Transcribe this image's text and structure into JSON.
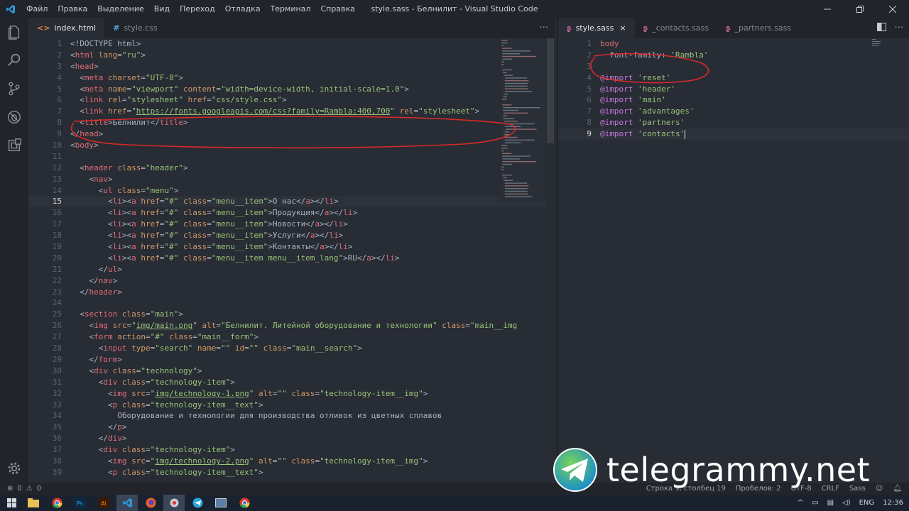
{
  "window": {
    "title": "style.sass - Белнилит - Visual Studio Code",
    "menu": [
      "Файл",
      "Правка",
      "Выделение",
      "Вид",
      "Переход",
      "Отладка",
      "Терминал",
      "Справка"
    ]
  },
  "left_editor": {
    "tabs": [
      {
        "label": "index.html",
        "icon": "html-file-icon",
        "active": true
      },
      {
        "label": "style.css",
        "icon": "css-file-icon",
        "active": false
      }
    ],
    "more_label": "···",
    "current_line": 15,
    "lines": [
      {
        "n": "1",
        "indent": "",
        "html": "<span class='p'>&lt;!DOCTYPE html&gt;</span>"
      },
      {
        "n": "2",
        "indent": "",
        "html": "<span class='p'>&lt;</span><span class='t'>html</span> <span class='a'>lang</span><span class='p'>=</span><span class='s'>\"ru\"</span><span class='p'>&gt;</span>"
      },
      {
        "n": "3",
        "indent": "",
        "html": "<span class='p'>&lt;</span><span class='t'>head</span><span class='p'>&gt;</span>"
      },
      {
        "n": "4",
        "indent": "  ",
        "html": "<span class='p'>&lt;</span><span class='t'>meta</span> <span class='a'>charset</span><span class='p'>=</span><span class='s'>\"UTF-8\"</span><span class='p'>&gt;</span>"
      },
      {
        "n": "5",
        "indent": "  ",
        "html": "<span class='p'>&lt;</span><span class='t'>meta</span> <span class='a'>name</span><span class='p'>=</span><span class='s'>\"viewport\"</span> <span class='a'>content</span><span class='p'>=</span><span class='s'>\"width=device-width, initial-scale=1.0\"</span><span class='p'>&gt;</span>"
      },
      {
        "n": "6",
        "indent": "  ",
        "html": "<span class='p'>&lt;</span><span class='t'>link</span> <span class='a'>rel</span><span class='p'>=</span><span class='s'>\"stylesheet\"</span> <span class='a'>href</span><span class='p'>=</span><span class='s'>\"css/style.css\"</span><span class='p'>&gt;</span>"
      },
      {
        "n": "7",
        "indent": "  ",
        "html": "<span class='p'>&lt;</span><span class='t'>link</span> <span class='a'>href</span><span class='p'>=</span><span class='s'>\"</span><span class='u'>https://fonts.googleapis.com/css?family=Rambla:400,700</span><span class='s'>\"</span> <span class='a'>rel</span><span class='p'>=</span><span class='s'>\"stylesheet\"</span><span class='p'>&gt;</span>"
      },
      {
        "n": "8",
        "indent": "  ",
        "html": "<span class='p'>&lt;</span><span class='t'>title</span><span class='p'>&gt;</span><span class='p'>Белнилит</span><span class='p'>&lt;/</span><span class='t'>title</span><span class='p'>&gt;</span>"
      },
      {
        "n": "9",
        "indent": "",
        "html": "<span class='p'>&lt;/</span><span class='t'>head</span><span class='p'>&gt;</span>"
      },
      {
        "n": "10",
        "indent": "",
        "html": "<span class='p'>&lt;</span><span class='t'>body</span><span class='p'>&gt;</span>"
      },
      {
        "n": "11",
        "indent": "",
        "html": ""
      },
      {
        "n": "12",
        "indent": "  ",
        "html": "<span class='p'>&lt;</span><span class='t'>header</span> <span class='a'>class</span><span class='p'>=</span><span class='s'>\"header\"</span><span class='p'>&gt;</span>"
      },
      {
        "n": "13",
        "indent": "    ",
        "html": "<span class='p'>&lt;</span><span class='t'>nav</span><span class='p'>&gt;</span>"
      },
      {
        "n": "14",
        "indent": "      ",
        "html": "<span class='p'>&lt;</span><span class='t'>ul</span> <span class='a'>class</span><span class='p'>=</span><span class='s'>\"menu\"</span><span class='p'>&gt;</span>"
      },
      {
        "n": "15",
        "indent": "        ",
        "html": "<span class='p'>&lt;</span><span class='t'>li</span><span class='p'>&gt;&lt;</span><span class='t'>a</span> <span class='a'>href</span><span class='p'>=</span><span class='s'>\"#\"</span> <span class='a'>class</span><span class='p'>=</span><span class='s'>\"menu__item\"</span><span class='p'>&gt;О нас&lt;/</span><span class='t'>a</span><span class='p'>&gt;&lt;/</span><span class='t'>li</span><span class='p'>&gt;</span>"
      },
      {
        "n": "16",
        "indent": "        ",
        "html": "<span class='p'>&lt;</span><span class='t'>li</span><span class='p'>&gt;&lt;</span><span class='t'>a</span> <span class='a'>href</span><span class='p'>=</span><span class='s'>\"#\"</span> <span class='a'>class</span><span class='p'>=</span><span class='s'>\"menu__item\"</span><span class='p'>&gt;Продукция&lt;/</span><span class='t'>a</span><span class='p'>&gt;&lt;/</span><span class='t'>li</span><span class='p'>&gt;</span>"
      },
      {
        "n": "17",
        "indent": "        ",
        "html": "<span class='p'>&lt;</span><span class='t'>li</span><span class='p'>&gt;&lt;</span><span class='t'>a</span> <span class='a'>href</span><span class='p'>=</span><span class='s'>\"#\"</span> <span class='a'>class</span><span class='p'>=</span><span class='s'>\"menu__item\"</span><span class='p'>&gt;Новости&lt;/</span><span class='t'>a</span><span class='p'>&gt;&lt;/</span><span class='t'>li</span><span class='p'>&gt;</span>"
      },
      {
        "n": "18",
        "indent": "        ",
        "html": "<span class='p'>&lt;</span><span class='t'>li</span><span class='p'>&gt;&lt;</span><span class='t'>a</span> <span class='a'>href</span><span class='p'>=</span><span class='s'>\"#\"</span> <span class='a'>class</span><span class='p'>=</span><span class='s'>\"menu__item\"</span><span class='p'>&gt;Услуги&lt;/</span><span class='t'>a</span><span class='p'>&gt;&lt;/</span><span class='t'>li</span><span class='p'>&gt;</span>"
      },
      {
        "n": "19",
        "indent": "        ",
        "html": "<span class='p'>&lt;</span><span class='t'>li</span><span class='p'>&gt;&lt;</span><span class='t'>a</span> <span class='a'>href</span><span class='p'>=</span><span class='s'>\"#\"</span> <span class='a'>class</span><span class='p'>=</span><span class='s'>\"menu__item\"</span><span class='p'>&gt;Контакты&lt;/</span><span class='t'>a</span><span class='p'>&gt;&lt;/</span><span class='t'>li</span><span class='p'>&gt;</span>"
      },
      {
        "n": "20",
        "indent": "        ",
        "html": "<span class='p'>&lt;</span><span class='t'>li</span><span class='p'>&gt;&lt;</span><span class='t'>a</span> <span class='a'>href</span><span class='p'>=</span><span class='s'>\"#\"</span> <span class='a'>class</span><span class='p'>=</span><span class='s'>\"menu__item menu__item_lang\"</span><span class='p'>&gt;RU&lt;/</span><span class='t'>a</span><span class='p'>&gt;&lt;/</span><span class='t'>li</span><span class='p'>&gt;</span>"
      },
      {
        "n": "21",
        "indent": "      ",
        "html": "<span class='p'>&lt;/</span><span class='t'>ul</span><span class='p'>&gt;</span>"
      },
      {
        "n": "22",
        "indent": "    ",
        "html": "<span class='p'>&lt;/</span><span class='t'>nav</span><span class='p'>&gt;</span>"
      },
      {
        "n": "23",
        "indent": "  ",
        "html": "<span class='p'>&lt;/</span><span class='t'>header</span><span class='p'>&gt;</span>"
      },
      {
        "n": "24",
        "indent": "",
        "html": ""
      },
      {
        "n": "25",
        "indent": "  ",
        "html": "<span class='p'>&lt;</span><span class='t'>section</span> <span class='a'>class</span><span class='p'>=</span><span class='s'>\"main\"</span><span class='p'>&gt;</span>"
      },
      {
        "n": "26",
        "indent": "    ",
        "html": "<span class='p'>&lt;</span><span class='t'>img</span> <span class='a'>src</span><span class='p'>=</span><span class='s'>\"</span><span class='u'>img/main.png</span><span class='s'>\"</span> <span class='a'>alt</span><span class='p'>=</span><span class='s'>\"Белнилит. Литейной оборудование и технологии\"</span> <span class='a'>class</span><span class='p'>=</span><span class='s'>\"main__img</span>"
      },
      {
        "n": "27",
        "indent": "    ",
        "html": "<span class='p'>&lt;</span><span class='t'>form</span> <span class='a'>action</span><span class='p'>=</span><span class='s'>\"#\"</span> <span class='a'>class</span><span class='p'>=</span><span class='s'>\"main__form\"</span><span class='p'>&gt;</span>"
      },
      {
        "n": "28",
        "indent": "      ",
        "html": "<span class='p'>&lt;</span><span class='t'>input</span> <span class='a'>type</span><span class='p'>=</span><span class='s'>\"search\"</span> <span class='a'>name</span><span class='p'>=</span><span class='s'>\"\"</span> <span class='a'>id</span><span class='p'>=</span><span class='s'>\"\"</span> <span class='a'>class</span><span class='p'>=</span><span class='s'>\"main__search\"</span><span class='p'>&gt;</span>"
      },
      {
        "n": "29",
        "indent": "    ",
        "html": "<span class='p'>&lt;/</span><span class='t'>form</span><span class='p'>&gt;</span>"
      },
      {
        "n": "30",
        "indent": "    ",
        "html": "<span class='p'>&lt;</span><span class='t'>div</span> <span class='a'>class</span><span class='p'>=</span><span class='s'>\"technology\"</span><span class='p'>&gt;</span>"
      },
      {
        "n": "31",
        "indent": "      ",
        "html": "<span class='p'>&lt;</span><span class='t'>div</span> <span class='a'>class</span><span class='p'>=</span><span class='s'>\"technology-item\"</span><span class='p'>&gt;</span>"
      },
      {
        "n": "32",
        "indent": "        ",
        "html": "<span class='p'>&lt;</span><span class='t'>img</span> <span class='a'>src</span><span class='p'>=</span><span class='s'>\"</span><span class='u'>img/technology-1.png</span><span class='s'>\"</span> <span class='a'>alt</span><span class='p'>=</span><span class='s'>\"\"</span> <span class='a'>class</span><span class='p'>=</span><span class='s'>\"technology-item__img\"</span><span class='p'>&gt;</span>"
      },
      {
        "n": "33",
        "indent": "        ",
        "html": "<span class='p'>&lt;</span><span class='t'>p</span> <span class='a'>class</span><span class='p'>=</span><span class='s'>\"technology-item__text\"</span><span class='p'>&gt;</span>"
      },
      {
        "n": "34",
        "indent": "          ",
        "html": "<span class='p'>Оборудование и технологии для производства отливок из цветных сплавов</span>"
      },
      {
        "n": "35",
        "indent": "        ",
        "html": "<span class='p'>&lt;/</span><span class='t'>p</span><span class='p'>&gt;</span>"
      },
      {
        "n": "36",
        "indent": "      ",
        "html": "<span class='p'>&lt;/</span><span class='t'>div</span><span class='p'>&gt;</span>"
      },
      {
        "n": "37",
        "indent": "      ",
        "html": "<span class='p'>&lt;</span><span class='t'>div</span> <span class='a'>class</span><span class='p'>=</span><span class='s'>\"technology-item\"</span><span class='p'>&gt;</span>"
      },
      {
        "n": "38",
        "indent": "        ",
        "html": "<span class='p'>&lt;</span><span class='t'>img</span> <span class='a'>src</span><span class='p'>=</span><span class='s'>\"</span><span class='u'>img/technology-2.png</span><span class='s'>\"</span> <span class='a'>alt</span><span class='p'>=</span><span class='s'>\"\"</span> <span class='a'>class</span><span class='p'>=</span><span class='s'>\"technology-item__img\"</span><span class='p'>&gt;</span>"
      },
      {
        "n": "39",
        "indent": "        ",
        "html": "<span class='p'>&lt;</span><span class='t'>p</span> <span class='a'>class</span><span class='p'>=</span><span class='s'>\"technology-item__text\"</span><span class='p'>&gt;</span>"
      }
    ]
  },
  "right_editor": {
    "tabs": [
      {
        "label": "style.sass",
        "icon": "sass-file-icon",
        "active": true,
        "close": "×"
      },
      {
        "label": "_contacts.sass",
        "icon": "sass-file-icon",
        "active": false
      },
      {
        "label": "_partners.sass",
        "icon": "sass-file-icon",
        "active": false
      }
    ],
    "lines": [
      {
        "n": "1",
        "html": "<span class='t'>body</span>"
      },
      {
        "n": "2",
        "html": "  <span class='p'>font-family: </span><span class='s'>'Rambla'</span>"
      },
      {
        "n": "3",
        "html": ""
      },
      {
        "n": "4",
        "html": "<span class='kw'>@import</span> <span class='s'>'reset'</span>"
      },
      {
        "n": "5",
        "html": "<span class='kw'>@import</span> <span class='s'>'header'</span>"
      },
      {
        "n": "6",
        "html": "<span class='kw'>@import</span> <span class='s'>'main'</span>"
      },
      {
        "n": "7",
        "html": "<span class='kw'>@import</span> <span class='s'>'advantages'</span>"
      },
      {
        "n": "8",
        "html": "<span class='kw'>@import</span> <span class='s'>'partners'</span>"
      },
      {
        "n": "9",
        "html": "<span class='kw'>@import</span> <span class='s'>'contacts'</span>"
      }
    ],
    "current_line": 9
  },
  "statusbar": {
    "errors": "0",
    "warnings": "0",
    "position": "Строка 9, столбец 19",
    "spaces": "Пробелов: 2",
    "encoding": "UTF-8",
    "eol": "CRLF",
    "language": "Sass"
  },
  "taskbar": {
    "language": "ENG",
    "time": "12:36"
  },
  "watermark": {
    "text": "telegrammy.net"
  },
  "colors": {
    "annotation": "#d92a2a",
    "accent": "#2d9ad8"
  }
}
